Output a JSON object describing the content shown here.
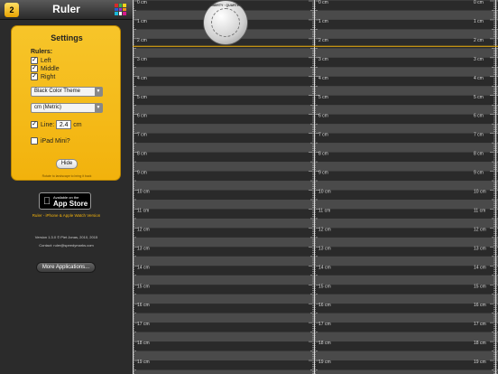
{
  "app": {
    "title": "Ruler",
    "icon_glyph": "2",
    "grid_colors": [
      "#d62a2a",
      "#3cb24a",
      "#f2d21b",
      "#2a5ad6",
      "#a02ad6",
      "#f28c1b",
      "#1bb8d6",
      "#ffffff",
      "#d61b8c"
    ]
  },
  "settings": {
    "title": "Settings",
    "rulers_label": "Rulers:",
    "rulers": [
      {
        "label": "Left",
        "checked": true
      },
      {
        "label": "Middle",
        "checked": true
      },
      {
        "label": "Right",
        "checked": true
      }
    ],
    "theme_selected": "Black Color Theme",
    "unit_selected": "cm (Metric)",
    "line_label": "Line:",
    "line_value": "2.4",
    "line_unit": "cm",
    "line_checked": true,
    "ipad_mini_label": "iPad Mini?",
    "ipad_mini_checked": false,
    "hide_label": "Hide",
    "rotate_note": "Rotate to landscape to bring it back"
  },
  "appstore": {
    "small_text": "Available on the",
    "big_text": "App Store"
  },
  "promo_link": "Ruler - iPhone & Apple Watch Version",
  "version_text": "Version 1.3.0      © Piet Jonas, 2010, 2015",
  "contact_text": "Contact: ruler@speedymarks.com",
  "more_apps_label": "More Applications...",
  "ruler": {
    "unit": "cm",
    "labels": [
      "0 cm",
      "1 cm",
      "2 cm",
      "3 cm",
      "4 cm",
      "5 cm",
      "6 cm",
      "7 cm",
      "8 cm",
      "9 cm",
      "10 cm",
      "11 cm",
      "12 cm",
      "13 cm",
      "14 cm",
      "15 cm",
      "16 cm",
      "17 cm",
      "18 cm",
      "19 cm"
    ],
    "line_color": "#f2b20c",
    "band_dark": "#2a2a2a",
    "band_light": "#4a4a4a"
  },
  "coin": {
    "text": "LIBERTY · QUARTER"
  }
}
